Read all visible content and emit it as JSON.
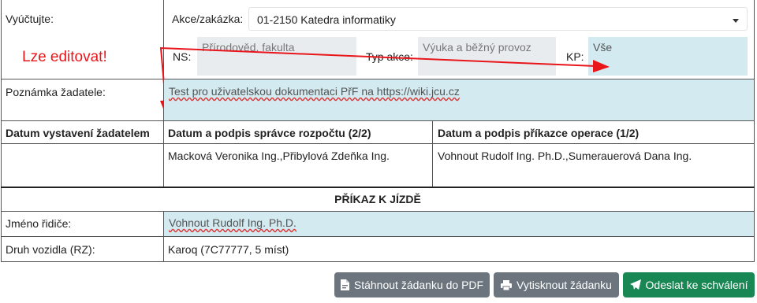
{
  "vyuctujte": {
    "label": "Vyúčtujte:",
    "akce_label": "Akce/zakázka:",
    "akce_value": "01-2150 Katedra informatiky",
    "ns_label": "NS:",
    "ns_value": "Přírodověd. fakulta",
    "typ_label": "Typ akce:",
    "typ_value": "Výuka a běžný provoz",
    "kp_label": "KP:",
    "kp_value": "Vše"
  },
  "annotation": {
    "text": "Lze editovat!",
    "color": "#e8161b"
  },
  "poznamka": {
    "label": "Poznámka žadatele:",
    "value": "Test pro uživatelskou dokumentaci PřF na https://wiki.jcu.cz"
  },
  "signatures": {
    "col1_header": "Datum vystavení žadatelem",
    "col2_header": "Datum a podpis správce rozpočtu (2/2)",
    "col3_header": "Datum a podpis příkazce operace (1/2)",
    "col1_value": "",
    "col2_value": "Macková Veronika Ing.,Přibylová Zdeňka Ing.",
    "col3_value": "Vohnout Rudolf Ing. Ph.D.,Sumerauerová Dana Ing."
  },
  "prikaz": {
    "title": "PŘÍKAZ K JÍZDĚ",
    "ridic_label": "Jméno řidiče:",
    "ridic_value": "Vohnout Rudolf Ing. Ph.D.",
    "vozidlo_label": "Druh vozidla (RZ):",
    "vozidlo_value": "Karoq (7C77777, 5 míst)"
  },
  "buttons": {
    "pdf": "Stáhnout žádanku do PDF",
    "print": "Vytisknout žádanku",
    "send": "Odeslat ke schválení"
  },
  "icons": {
    "pdf": "file-pdf-icon",
    "print": "printer-icon",
    "send": "paper-plane-icon"
  },
  "colors": {
    "readonly_field": "#e9ecef",
    "editable_field": "#d2eaf0",
    "button_gray": "#6c757d",
    "button_green": "#198754"
  }
}
